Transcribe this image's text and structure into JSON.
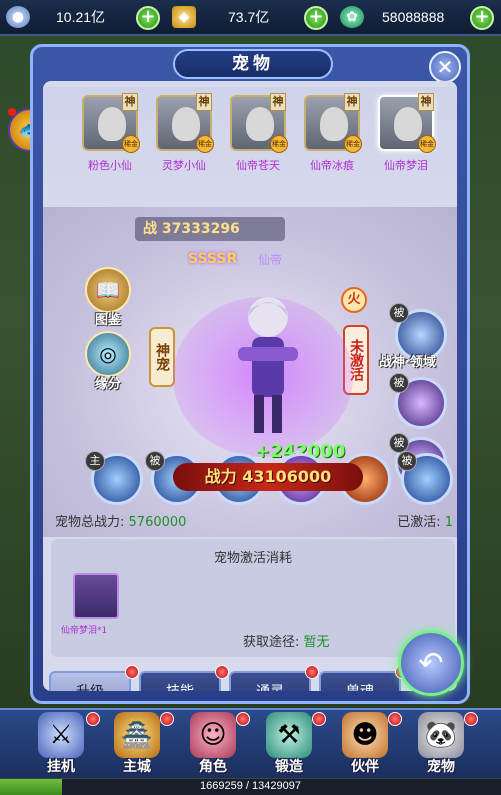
{
  "topbar": {
    "silver": "10.21亿",
    "gold": "73.7亿",
    "jade": "58088888",
    "plus": "+"
  },
  "panel": {
    "title": "宠物",
    "close": "✕"
  },
  "roster": [
    {
      "name": "粉色小仙",
      "god": "神",
      "grade": "稀金"
    },
    {
      "name": "灵梦小仙",
      "god": "神",
      "grade": "稀金"
    },
    {
      "name": "仙帝苍天",
      "god": "神",
      "grade": "稀金"
    },
    {
      "name": "仙帝冰痕",
      "god": "神",
      "grade": "稀金"
    },
    {
      "name": "仙帝梦泪",
      "god": "神",
      "grade": "稀金"
    }
  ],
  "stage": {
    "top_power_label": "战 37333296",
    "rank": "SSSSR",
    "rank_sub": "仙帝",
    "left_buttons": [
      {
        "label": "图鉴"
      },
      {
        "label": "缘分"
      }
    ],
    "shen_tag": "神宠",
    "fire_tag": "火",
    "inactive_tag": "未激活",
    "right_skill": {
      "label": "战神·领域",
      "bei": "被"
    },
    "bei": "被",
    "zhu": "主",
    "plus_power": "+242000",
    "battle_power": "战力 43106000",
    "total_power_label": "宠物总战力:",
    "total_power_value": "5760000",
    "activated_label": "已激活:",
    "activated_value": "1"
  },
  "cost": {
    "title": "宠物激活消耗",
    "item_name": "仙帝梦泪*1",
    "acquire_label": "获取途径:",
    "acquire_value": "暂无"
  },
  "tabs": [
    "升级",
    "技能",
    "通灵",
    "兽魂"
  ],
  "bottom_nav": [
    "挂机",
    "主城",
    "角色",
    "锻造",
    "伙伴",
    "宠物"
  ],
  "exp": {
    "text": "1669259 / 13429097",
    "fraction": 0.124
  },
  "colors": {
    "accent": "#8fb3ff",
    "name_purple": "#b02fd0",
    "value_green": "#1f8f2a"
  }
}
